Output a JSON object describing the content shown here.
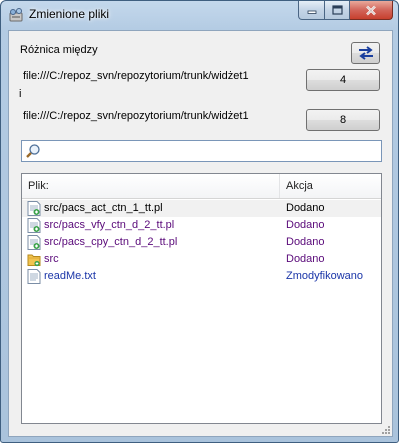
{
  "window": {
    "title": "Zmienione pliki"
  },
  "diff": {
    "label": "Różnica między",
    "url1": "file:///C:/repoz_svn/repozytorium/trunk/widżet1",
    "rev1": "4",
    "conj": "i",
    "url2": "file:///C:/repoz_svn/repozytorium/trunk/widżet1",
    "rev2": "8"
  },
  "search": {
    "placeholder": "",
    "value": ""
  },
  "list": {
    "headers": {
      "file": "Plik:",
      "action": "Akcja"
    },
    "rows": [
      {
        "file": "src/pacs_act_ctn_1_tt.pl",
        "action": "Dodano",
        "icon": "file-added-icon",
        "color": "#000000"
      },
      {
        "file": "src/pacs_vfy_ctn_d_2_tt.pl",
        "action": "Dodano",
        "icon": "file-added-icon",
        "color": "#5a0a7a"
      },
      {
        "file": "src/pacs_cpy_ctn_d_2_tt.pl",
        "action": "Dodano",
        "icon": "file-added-icon",
        "color": "#5a0a7a"
      },
      {
        "file": "src",
        "action": "Dodano",
        "icon": "folder-icon",
        "color": "#5a0a7a"
      },
      {
        "file": "readMe.txt",
        "action": "Zmodyfikowano",
        "icon": "text-file-icon",
        "color": "#1a35a8"
      }
    ]
  },
  "colors": {
    "added": "#5a0a7a",
    "modified": "#1a35a8",
    "titlebar": "#b3cbe3"
  }
}
